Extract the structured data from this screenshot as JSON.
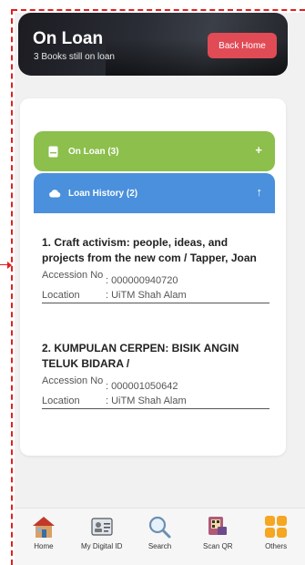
{
  "header": {
    "title": "On Loan",
    "subtitle": "3 Books still on loan",
    "back_label": "Back Home"
  },
  "accordion": {
    "on_loan_label": "On Loan (3)",
    "on_loan_toggle": "+",
    "history_label": "Loan History (2)",
    "history_toggle": "↑"
  },
  "books": [
    {
      "title": "1. Craft activism: people, ideas, and projects from the new com / Tapper, Joan",
      "accession_label": "Accession No",
      "accession": ": 000000940720",
      "location_label": "Location",
      "location": ": UiTM Shah Alam"
    },
    {
      "title": "2. KUMPULAN CERPEN: BISIK ANGIN TELUK BIDARA /",
      "accession_label": "Accession No",
      "accession": ": 000001050642",
      "location_label": "Location",
      "location": ": UiTM Shah Alam"
    }
  ],
  "nav": [
    {
      "label": "Home",
      "icon": "home-icon"
    },
    {
      "label": "My Digital ID",
      "icon": "id-card-icon"
    },
    {
      "label": "Search",
      "icon": "search-icon"
    },
    {
      "label": "Scan QR",
      "icon": "scan-qr-icon"
    },
    {
      "label": "Others",
      "icon": "grid-icon"
    }
  ],
  "colors": {
    "on_loan": "#8cbf4c",
    "history": "#4a90dc",
    "back_button": "#e14b55",
    "others_icon": "#f5a623"
  }
}
